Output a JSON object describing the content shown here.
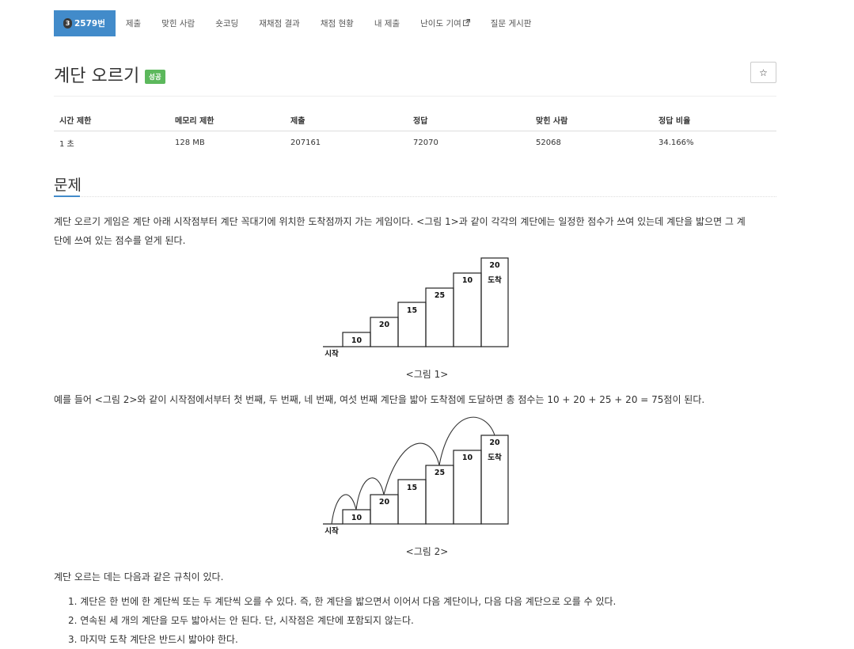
{
  "nav": {
    "problem_number_badge": "3",
    "problem_number": "2579번",
    "tabs": [
      "제출",
      "맞힌 사람",
      "숏코딩",
      "재채점 결과",
      "채점 현황",
      "내 제출",
      "난이도 기여",
      "질문 게시판"
    ]
  },
  "title": "계단 오르기",
  "status_badge": "성공",
  "star_label": "☆",
  "info_table": {
    "headers": [
      "시간 제한",
      "메모리 제한",
      "제출",
      "정답",
      "맞힌 사람",
      "정답 비율"
    ],
    "values": [
      "1 초",
      "128 MB",
      "207161",
      "72070",
      "52068",
      "34.166%"
    ]
  },
  "section_title": "문제",
  "paragraph1_line1": "계단 오르기 게임은 계단 아래 시작점부터 계단 꼭대기에 위치한 도착점까지 가는 게임이다. <그림 1>과 같이 각각의 계단에는 일정한 점수가 쓰여 있는데 계단을 밟으면 그 계",
  "paragraph1_line2": "단에 쓰여 있는 점수를 얻게 된다.",
  "figure": {
    "step_scores": [
      "10",
      "20",
      "15",
      "25",
      "10",
      "20"
    ],
    "start_label": "시작",
    "end_label": "도착"
  },
  "caption1": "<그림 1>",
  "paragraph2": "예를 들어 <그림 2>와 같이 시작점에서부터 첫 번째, 두 번째, 네 번째, 여섯 번째 계단을 밟아 도착점에 도달하면 총 점수는 10 + 20 + 25 + 20 = 75점이 된다.",
  "caption2": "<그림 2>",
  "paragraph3": "계단 오르는 데는 다음과 같은 규칙이 있다.",
  "rules": [
    "1. 계단은 한 번에 한 계단씩 또는 두 계단씩 오를 수 있다. 즉, 한 계단을 밟으면서 이어서 다음 계단이나, 다음 다음 계단으로 오를 수 있다.",
    "2. 연속된 세 개의 계단을 모두 밟아서는 안 된다. 단, 시작점은 계단에 포함되지 않는다.",
    "3. 마지막 도착 계단은 반드시 밟아야 한다."
  ]
}
